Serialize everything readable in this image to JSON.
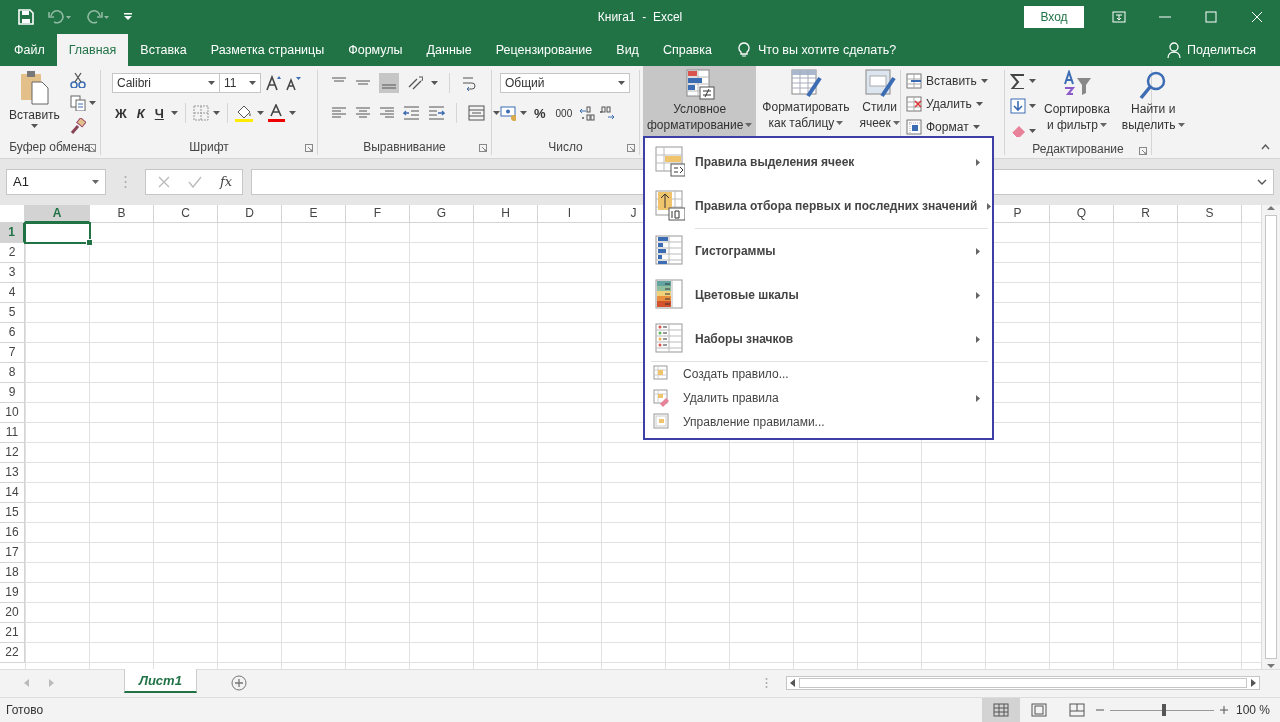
{
  "title_bar": {
    "title": "Книга1  -  Excel",
    "sign_in": "Вход"
  },
  "tabs": [
    {
      "label": "Файл",
      "selected": false
    },
    {
      "label": "Главная",
      "selected": true
    },
    {
      "label": "Вставка",
      "selected": false
    },
    {
      "label": "Разметка страницы",
      "selected": false
    },
    {
      "label": "Формулы",
      "selected": false
    },
    {
      "label": "Данные",
      "selected": false
    },
    {
      "label": "Рецензирование",
      "selected": false
    },
    {
      "label": "Вид",
      "selected": false
    },
    {
      "label": "Справка",
      "selected": false
    }
  ],
  "tell_me": "Что вы хотите сделать?",
  "share": "Поделиться",
  "ribbon": {
    "clipboard": {
      "paste": "Вставить",
      "label": "Буфер обмена"
    },
    "font": {
      "name": "Calibri",
      "size": "11",
      "bold": "Ж",
      "italic": "К",
      "underline": "Ч",
      "label": "Шрифт"
    },
    "alignment": {
      "label": "Выравнивание"
    },
    "number": {
      "format": "Общий",
      "percent": "%",
      "thousands": "000",
      "label": "Число"
    },
    "styles": {
      "buttons": [
        {
          "lines": [
            "Условное",
            "форматирование"
          ],
          "selected": true
        },
        {
          "lines": [
            "Форматировать",
            "как таблицу"
          ],
          "selected": false
        },
        {
          "lines": [
            "Стили",
            "ячеек"
          ],
          "selected": false
        }
      ]
    },
    "cells": {
      "buttons": [
        "Вставить",
        "Удалить",
        "Формат"
      ]
    },
    "editing": {
      "buttons": [
        {
          "lines": [
            "Сортировка",
            "и фильтр"
          ]
        },
        {
          "lines": [
            "Найти и",
            "выделить"
          ]
        }
      ],
      "label": "Редактирование"
    }
  },
  "formula_bar": {
    "name_box": "A1",
    "fx": "fx"
  },
  "sheet": {
    "columns_left": [
      {
        "label": "A",
        "selected": true
      },
      {
        "label": "B",
        "selected": false
      },
      {
        "label": "C",
        "selected": false
      },
      {
        "label": "D",
        "selected": false
      },
      {
        "label": "E",
        "selected": false
      },
      {
        "label": "F",
        "selected": false
      },
      {
        "label": "G",
        "selected": false
      },
      {
        "label": "H",
        "selected": false
      },
      {
        "label": "I",
        "selected": false
      },
      {
        "label": "J",
        "selected": false
      }
    ],
    "columns_right": [
      {
        "label": "P",
        "selected": false
      },
      {
        "label": "Q",
        "selected": false
      },
      {
        "label": "R",
        "selected": false
      },
      {
        "label": "S",
        "selected": false
      }
    ],
    "rows": [
      {
        "label": "1",
        "selected": true
      },
      {
        "label": "2",
        "selected": false
      },
      {
        "label": "3",
        "selected": false
      },
      {
        "label": "4",
        "selected": false
      },
      {
        "label": "5",
        "selected": false
      },
      {
        "label": "6",
        "selected": false
      },
      {
        "label": "7",
        "selected": false
      },
      {
        "label": "8",
        "selected": false
      },
      {
        "label": "9",
        "selected": false
      },
      {
        "label": "10",
        "selected": false
      },
      {
        "label": "11",
        "selected": false
      },
      {
        "label": "12",
        "selected": false
      },
      {
        "label": "13",
        "selected": false
      },
      {
        "label": "14",
        "selected": false
      },
      {
        "label": "15",
        "selected": false
      },
      {
        "label": "16",
        "selected": false
      },
      {
        "label": "17",
        "selected": false
      },
      {
        "label": "18",
        "selected": false
      },
      {
        "label": "19",
        "selected": false
      },
      {
        "label": "20",
        "selected": false
      },
      {
        "label": "21",
        "selected": false
      },
      {
        "label": "22",
        "selected": false
      }
    ]
  },
  "cf_menu": {
    "items": [
      {
        "kind": "large",
        "label": "Правила выделения ячеек",
        "submenu": true
      },
      {
        "kind": "large",
        "label": "Правила отбора первых и последних значений",
        "submenu": true
      },
      {
        "kind": "separator"
      },
      {
        "kind": "large",
        "label": "Гистограммы",
        "submenu": true
      },
      {
        "kind": "large",
        "label": "Цветовые шкалы",
        "submenu": true
      },
      {
        "kind": "large",
        "label": "Наборы значков",
        "submenu": true
      },
      {
        "kind": "separator"
      },
      {
        "kind": "small",
        "label": "Создать правило...",
        "submenu": false
      },
      {
        "kind": "small",
        "label": "Удалить правила",
        "submenu": true
      },
      {
        "kind": "small",
        "label": "Управление правилами...",
        "submenu": false
      }
    ]
  },
  "sheet_tabs": [
    {
      "label": "Лист1",
      "selected": true
    }
  ],
  "status_bar": {
    "status": "Готово",
    "views": [
      {
        "selected": true
      },
      {
        "selected": false
      },
      {
        "selected": false
      }
    ],
    "zoom": {
      "level": 0.52
    },
    "zoom_label": "100 %"
  }
}
